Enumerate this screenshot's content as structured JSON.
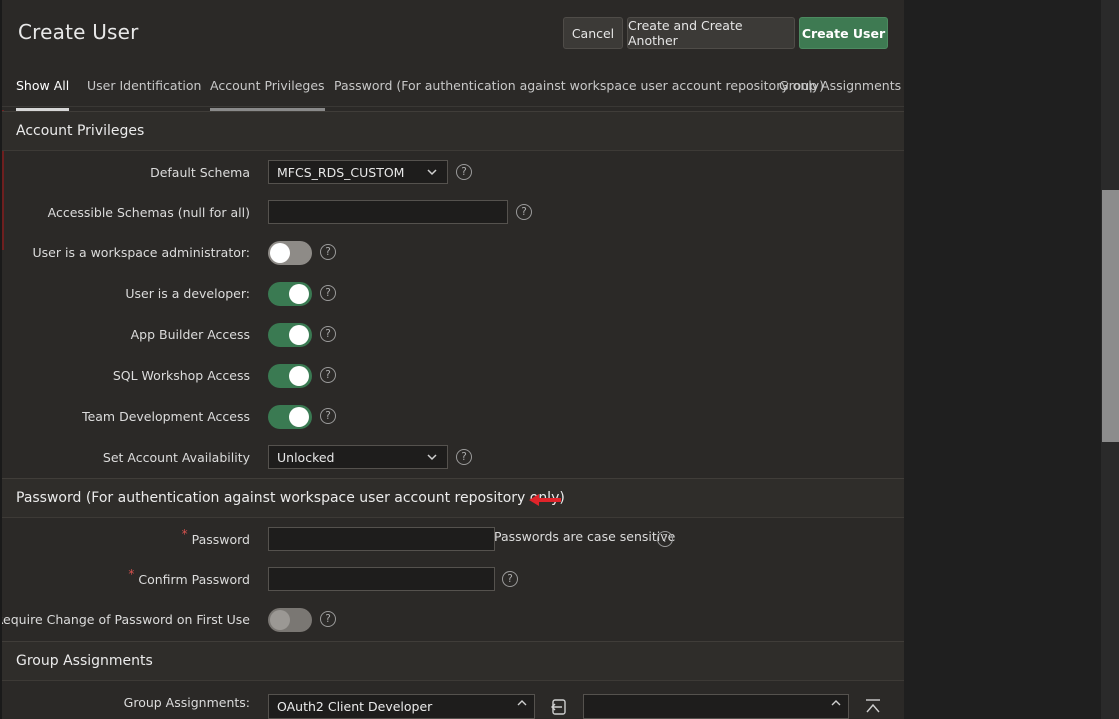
{
  "dialog": {
    "title": "Create User",
    "buttons": {
      "cancel": "Cancel",
      "create_another": "Create and Create Another",
      "create": "Create User"
    }
  },
  "tabs": [
    {
      "label": "Show All",
      "state": "active"
    },
    {
      "label": "User Identification"
    },
    {
      "label": "Account Privileges",
      "state": "hover"
    },
    {
      "label": "Password (For authentication against workspace user account repository only)"
    },
    {
      "label": "Group Assignments"
    }
  ],
  "account_privileges": {
    "heading": "Account Privileges",
    "default_schema": {
      "label": "Default Schema",
      "value": "MFCS_RDS_CUSTOM"
    },
    "accessible_schemas": {
      "label": "Accessible Schemas (null for all)",
      "value": ""
    },
    "workspace_admin": {
      "label": "User is a workspace administrator:",
      "on": false
    },
    "developer": {
      "label": "User is a developer:",
      "on": true
    },
    "app_builder": {
      "label": "App Builder Access",
      "on": true
    },
    "sql_workshop": {
      "label": "SQL Workshop Access",
      "on": true
    },
    "team_dev": {
      "label": "Team Development Access",
      "on": true
    },
    "availability": {
      "label": "Set Account Availability",
      "value": "Unlocked"
    }
  },
  "password": {
    "heading": "Password (For authentication against workspace user account repository only)",
    "password": {
      "label": "Password",
      "required_mark": "*",
      "note": "Passwords are case sensitive"
    },
    "confirm": {
      "label": "Confirm Password",
      "required_mark": "*"
    },
    "require_change": {
      "label": "Require Change of Password on First Use",
      "on": false
    }
  },
  "groups": {
    "heading": "Group Assignments",
    "label": "Group Assignments:",
    "available_first": "OAuth2 Client Developer"
  },
  "help_glyph": "?",
  "colors": {
    "accent_green": "#3e7a52",
    "annotation_arrow": "#e0242a",
    "required": "#d9534f"
  }
}
